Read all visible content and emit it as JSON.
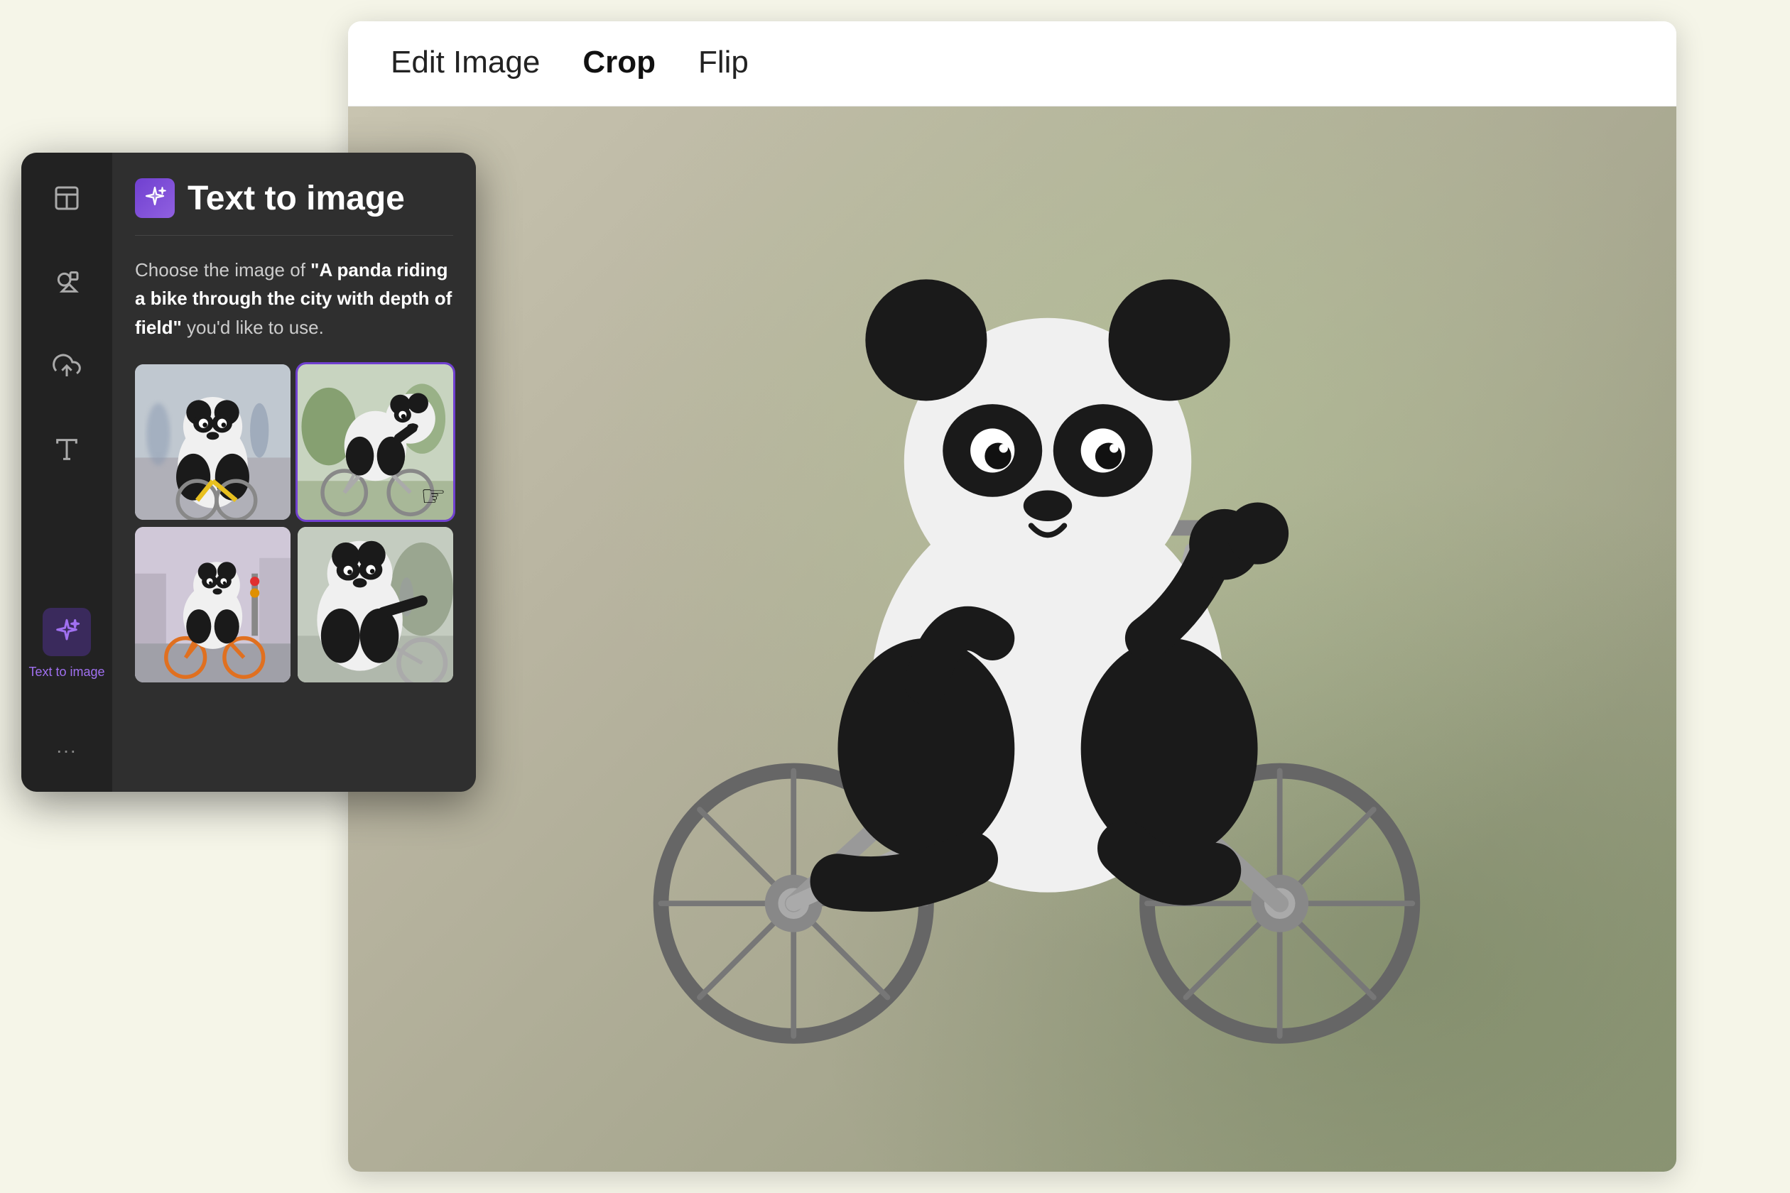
{
  "app": {
    "background_color": "#f5f5e8"
  },
  "image_editor": {
    "toolbar": {
      "tabs": [
        {
          "id": "edit-image",
          "label": "Edit Image",
          "active": false
        },
        {
          "id": "crop",
          "label": "Crop",
          "active": true
        },
        {
          "id": "flip",
          "label": "Flip",
          "active": false
        }
      ]
    }
  },
  "sidebar": {
    "icon_rail": {
      "icons": [
        {
          "id": "layout-icon",
          "symbol": "layout",
          "active": false
        },
        {
          "id": "shapes-icon",
          "symbol": "shapes",
          "active": false
        },
        {
          "id": "upload-icon",
          "symbol": "upload",
          "active": false
        },
        {
          "id": "text-icon",
          "symbol": "text",
          "active": false
        }
      ],
      "bottom": {
        "active_icon": {
          "id": "text-to-image-icon",
          "symbol": "magic",
          "active": true
        },
        "active_label": "Text to image",
        "dots_label": "..."
      }
    },
    "panel": {
      "title": "Text to image",
      "icon_emoji": "✦",
      "description_prefix": "Choose the image of ",
      "description_query": "A panda riding a bike through the city with depth of field",
      "description_suffix": " you'd like to use.",
      "images": [
        {
          "id": "panda-1",
          "alt": "Panda on bike city street",
          "selected": false
        },
        {
          "id": "panda-2",
          "alt": "Panda on bike park",
          "selected": true
        },
        {
          "id": "panda-3",
          "alt": "Panda on orange bike city",
          "selected": false
        },
        {
          "id": "panda-4",
          "alt": "Panda on bike street",
          "selected": false
        }
      ]
    }
  }
}
